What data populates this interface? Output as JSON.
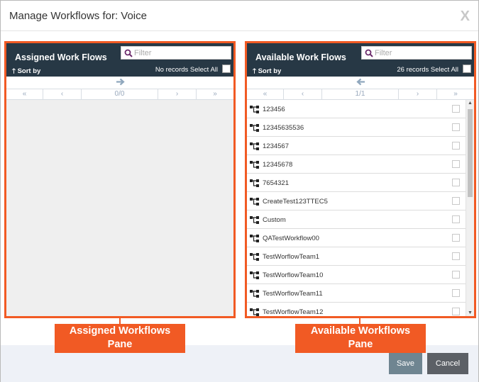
{
  "dialog": {
    "title": "Manage Workflows for: Voice",
    "close_label": "X"
  },
  "assigned": {
    "title": "Assigned Work Flows",
    "filter_placeholder": "Filter",
    "sort_label": "Sort by",
    "records_label": "No records",
    "select_all_label": "Select All",
    "pager": {
      "first": "«",
      "prev": "‹",
      "info": "0/0",
      "next": "›",
      "last": "»"
    }
  },
  "available": {
    "title": "Available Work Flows",
    "filter_placeholder": "Filter",
    "sort_label": "Sort by",
    "records_label": "26 records",
    "select_all_label": "Select All",
    "pager": {
      "first": "«",
      "prev": "‹",
      "info": "1/1",
      "next": "›",
      "last": "»"
    },
    "items": [
      "123456",
      "12345635536",
      "1234567",
      "12345678",
      "7654321",
      "CreateTest123TTEC5",
      "Custom",
      "QATestWorkflow00",
      "TestWorflowTeam1",
      "TestWorflowTeam10",
      "TestWorflowTeam11",
      "TestWorflowTeam12"
    ]
  },
  "callouts": {
    "assigned": {
      "line1": "Assigned Workflows",
      "line2": "Pane"
    },
    "available": {
      "line1": "Available Workflows",
      "line2": "Pane"
    }
  },
  "footer": {
    "save_label": "Save",
    "cancel_label": "Cancel"
  },
  "colors": {
    "header_bg": "#273845",
    "accent_orange": "#f15a24",
    "arrow_blue": "#8fa7bd",
    "filter_icon": "#6b2a6b"
  }
}
